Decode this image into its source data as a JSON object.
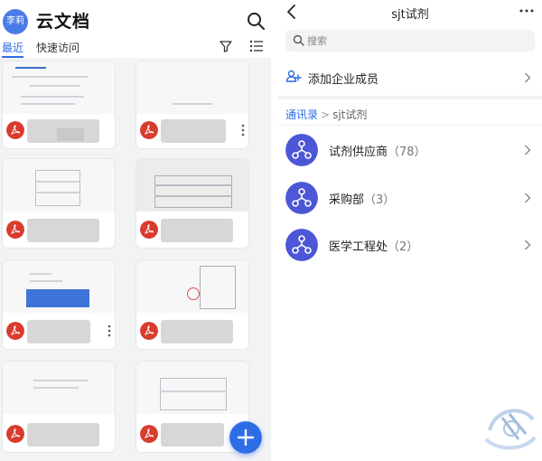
{
  "left": {
    "avatar_text": "李莉",
    "app_title": "云文档",
    "tabs": [
      {
        "label": "最近"
      },
      {
        "label": "快速访问"
      }
    ],
    "files": [
      {
        "type": "pdf"
      },
      {
        "type": "pdf"
      },
      {
        "type": "pdf"
      },
      {
        "type": "pdf"
      },
      {
        "type": "pdf"
      },
      {
        "type": "pdf"
      },
      {
        "type": "pdf"
      },
      {
        "type": "pdf"
      }
    ],
    "icons": [
      "search-icon",
      "filter-icon",
      "list-view-icon",
      "pdf-icon",
      "more-icon",
      "plus-icon"
    ]
  },
  "right": {
    "title": "sjt试剂",
    "search_placeholder": "搜索",
    "add_member_label": "添加企业成员",
    "breadcrumb": {
      "root": "通讯录",
      "separator": ">",
      "current": "sjt试剂"
    },
    "departments": [
      {
        "name": "试剂供应商",
        "count": "（78）"
      },
      {
        "name": "采购部",
        "count": "（3）"
      },
      {
        "name": "医学工程处",
        "count": "（2）"
      }
    ],
    "icons": [
      "back-icon",
      "more-icon",
      "search-icon",
      "add-member-icon",
      "org-chart-icon",
      "chevron-right-icon"
    ],
    "accent_color": "#2f6de6",
    "org_icon_color": "#4b57d6"
  }
}
